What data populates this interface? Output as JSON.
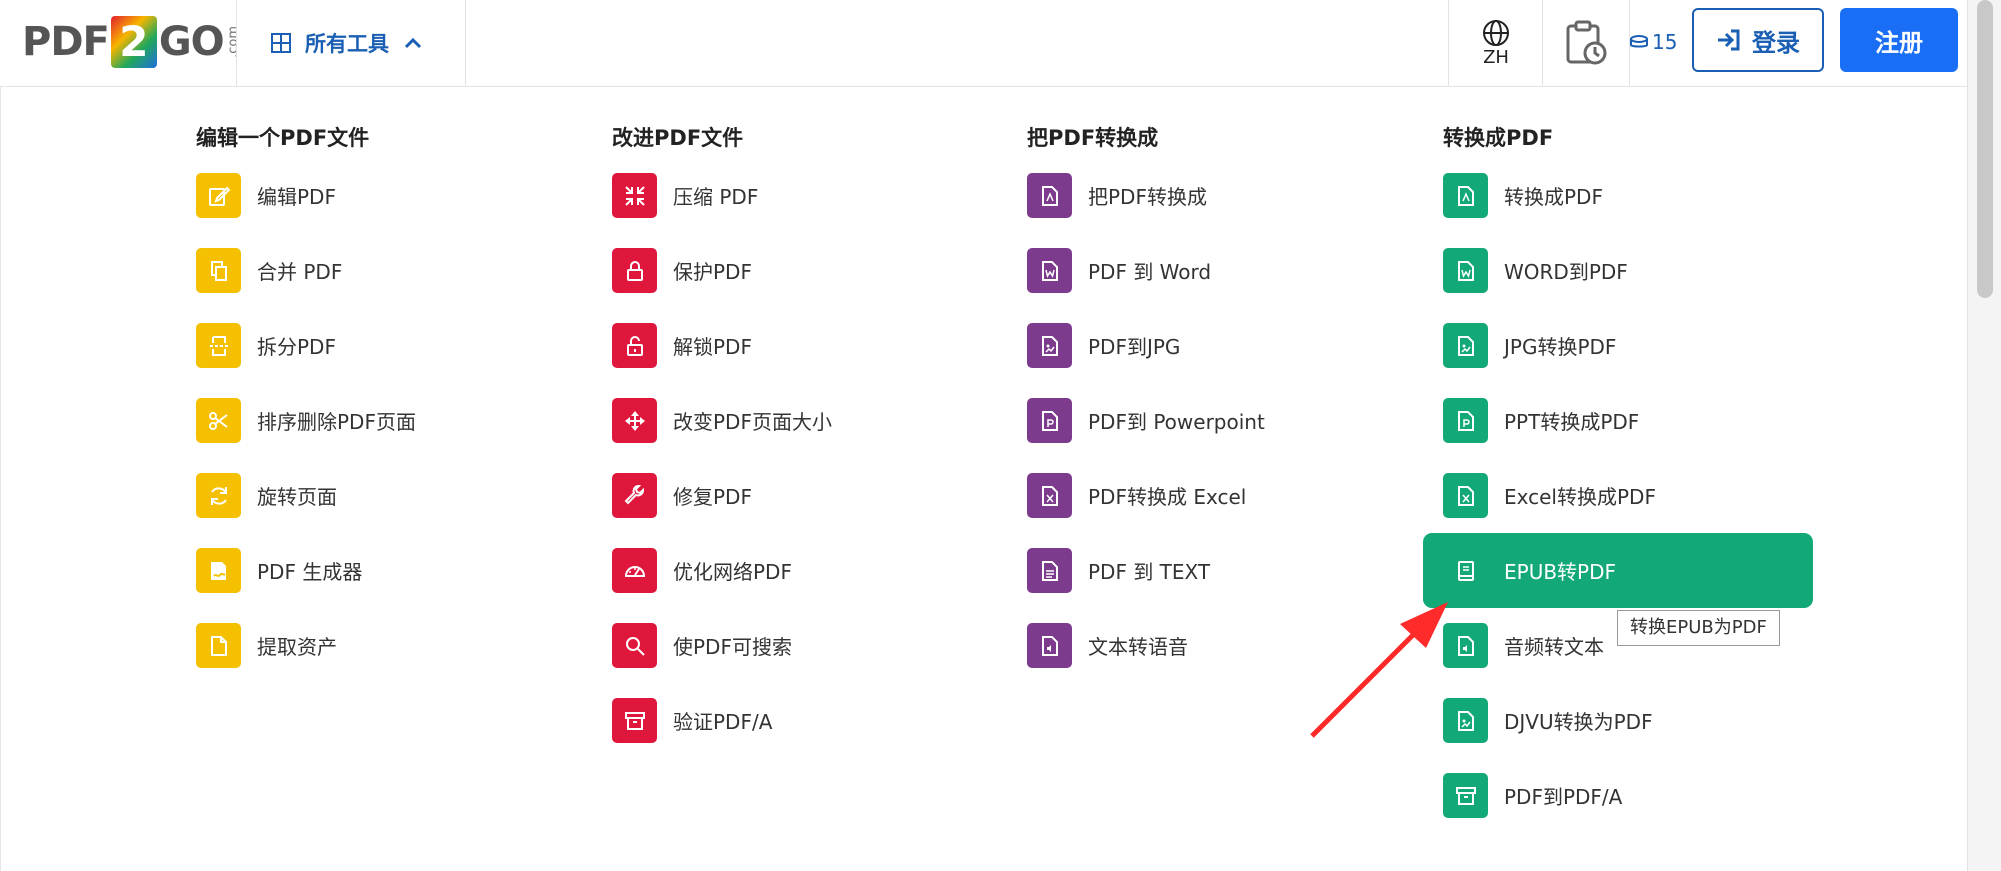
{
  "header": {
    "logo": {
      "pdf": "PDF",
      "two": "2",
      "go": "GO",
      "com": ".com"
    },
    "tools_label": "所有工具",
    "language": "ZH",
    "credits": "15",
    "login_label": "登录",
    "signup_label": "注册"
  },
  "columns": [
    {
      "title": "编辑一个PDF文件",
      "color": "#f5c000",
      "items": [
        {
          "label": "编辑PDF",
          "icon": "edit-icon"
        },
        {
          "label": "合并 PDF",
          "icon": "merge-icon"
        },
        {
          "label": "拆分PDF",
          "icon": "split-icon"
        },
        {
          "label": "排序删除PDF页面",
          "icon": "scissors-icon"
        },
        {
          "label": "旋转页面",
          "icon": "rotate-icon"
        },
        {
          "label": "PDF 生成器",
          "icon": "sign-icon"
        },
        {
          "label": "提取资产",
          "icon": "file-icon"
        }
      ]
    },
    {
      "title": "改进PDF文件",
      "color": "#e0173c",
      "items": [
        {
          "label": "压缩 PDF",
          "icon": "compress-icon"
        },
        {
          "label": "保护PDF",
          "icon": "lock-icon"
        },
        {
          "label": "解锁PDF",
          "icon": "unlock-icon"
        },
        {
          "label": "改变PDF页面大小",
          "icon": "move-icon"
        },
        {
          "label": "修复PDF",
          "icon": "wrench-icon"
        },
        {
          "label": "优化网络PDF",
          "icon": "gauge-icon"
        },
        {
          "label": "使PDF可搜索",
          "icon": "search-icon"
        },
        {
          "label": "验证PDF/A",
          "icon": "archive-icon"
        }
      ]
    },
    {
      "title": "把PDF转换成",
      "color": "#7c3b8c",
      "items": [
        {
          "label": "把PDF转换成",
          "icon": "pdf-file-icon"
        },
        {
          "label": "PDF 到 Word",
          "icon": "word-file-icon"
        },
        {
          "label": "PDF到JPG",
          "icon": "image-file-icon"
        },
        {
          "label": "PDF到 Powerpoint",
          "icon": "ppt-file-icon"
        },
        {
          "label": "PDF转换成 Excel",
          "icon": "excel-file-icon"
        },
        {
          "label": "PDF 到 TEXT",
          "icon": "text-file-icon"
        },
        {
          "label": "文本转语音",
          "icon": "audio-file-icon"
        }
      ]
    },
    {
      "title": "转换成PDF",
      "color": "#12a878",
      "items": [
        {
          "label": "转换成PDF",
          "icon": "pdf-file-icon"
        },
        {
          "label": "WORD到PDF",
          "icon": "word-file-icon"
        },
        {
          "label": "JPG转换PDF",
          "icon": "image-file-icon"
        },
        {
          "label": "PPT转换成PDF",
          "icon": "ppt-file-icon"
        },
        {
          "label": "Excel转换成PDF",
          "icon": "excel-file-icon"
        },
        {
          "label": "EPUB转PDF",
          "icon": "book-icon"
        },
        {
          "label": "音频转文本",
          "icon": "audio-file-icon"
        },
        {
          "label": "DJVU转换为PDF",
          "icon": "image-file-icon"
        },
        {
          "label": "PDF到PDF/A",
          "icon": "archive-icon"
        }
      ]
    }
  ],
  "tooltip": "转换EPUB为PDF"
}
